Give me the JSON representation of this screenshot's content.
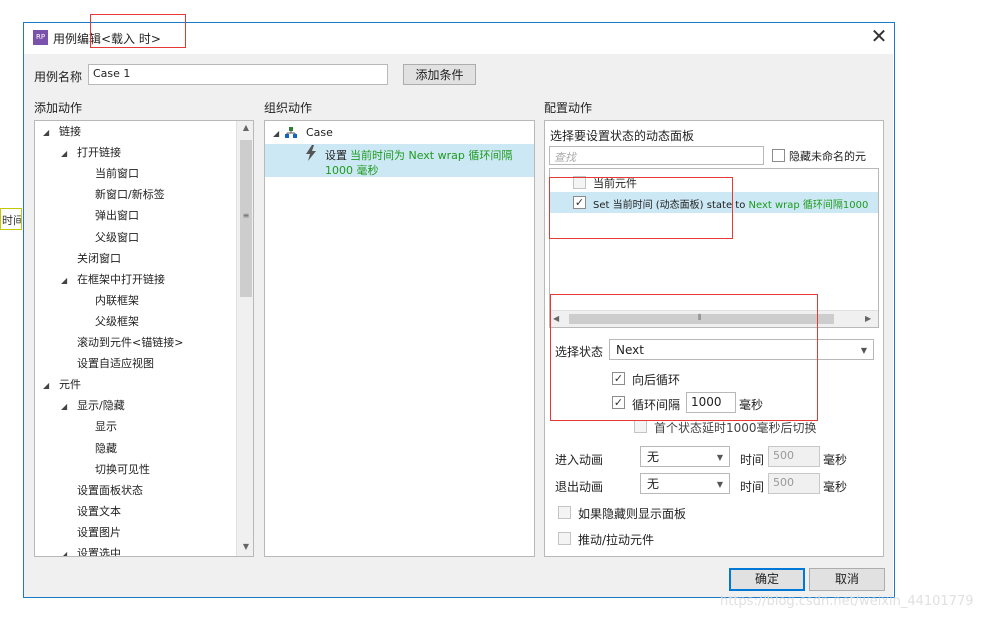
{
  "window": {
    "title": "用例编辑<载入 时>",
    "app_icon": "RP",
    "close_icon": "close-icon"
  },
  "side_fragment": "时间",
  "case_name": {
    "label": "用例名称",
    "value": "Case 1"
  },
  "add_condition_button": "添加条件",
  "sections": {
    "add_action": "添加动作",
    "organize_action": "组织动作",
    "configure_action": "配置动作"
  },
  "action_tree": [
    {
      "label": "链接",
      "level": 0,
      "expanded": true
    },
    {
      "label": "打开链接",
      "level": 1,
      "expanded": true
    },
    {
      "label": "当前窗口",
      "level": 2
    },
    {
      "label": "新窗口/新标签",
      "level": 2
    },
    {
      "label": "弹出窗口",
      "level": 2
    },
    {
      "label": "父级窗口",
      "level": 2
    },
    {
      "label": "关闭窗口",
      "level": 1
    },
    {
      "label": "在框架中打开链接",
      "level": 1,
      "expanded": true
    },
    {
      "label": "内联框架",
      "level": 2
    },
    {
      "label": "父级框架",
      "level": 2
    },
    {
      "label": "滚动到元件<锚链接>",
      "level": 1
    },
    {
      "label": "设置自适应视图",
      "level": 1
    },
    {
      "label": "元件",
      "level": 0,
      "expanded": true
    },
    {
      "label": "显示/隐藏",
      "level": 1,
      "expanded": true
    },
    {
      "label": "显示",
      "level": 2
    },
    {
      "label": "隐藏",
      "level": 2
    },
    {
      "label": "切换可见性",
      "level": 2
    },
    {
      "label": "设置面板状态",
      "level": 1
    },
    {
      "label": "设置文本",
      "level": 1
    },
    {
      "label": "设置图片",
      "level": 1
    },
    {
      "label": "设置选中",
      "level": 1,
      "expanded": true
    }
  ],
  "organize": {
    "case_label": "Case",
    "action_prefix": "设置",
    "action_line1": "当前时间为 Next wrap 循环间隔",
    "action_line2": "1000 毫秒"
  },
  "config": {
    "panel_label": "选择要设置状态的动态面板",
    "search_placeholder": "查找",
    "hide_unnamed_label": "隐藏未命名的元",
    "current_widget": "当前元件",
    "set_row_prefix": "Set 当前时间 (动态面板) state to ",
    "set_row_green": "Next wrap 循环间隔1000",
    "select_state_label": "选择状态",
    "select_state_value": "Next",
    "loop_backward_label": "向后循环",
    "loop_interval_label": "循环间隔",
    "loop_interval_value": "1000",
    "ms_label": "毫秒",
    "first_delay_label": "首个状态延时1000毫秒后切换",
    "enter_anim_label": "进入动画",
    "enter_anim_value": "无",
    "exit_anim_label": "退出动画",
    "exit_anim_value": "无",
    "time_label": "时间",
    "enter_time_value": "500",
    "exit_time_value": "500",
    "show_if_hidden_label": "如果隐藏则显示面板",
    "push_pull_label": "推动/拉动元件"
  },
  "buttons": {
    "ok": "确定",
    "cancel": "取消"
  },
  "watermark": "https://blog.csdn.net/weixin_44101779",
  "colors": {
    "accent": "#0078d7",
    "green_text": "#1e9b1e",
    "selected_row": "#cce8f4",
    "annotation_red": "#e53935"
  }
}
